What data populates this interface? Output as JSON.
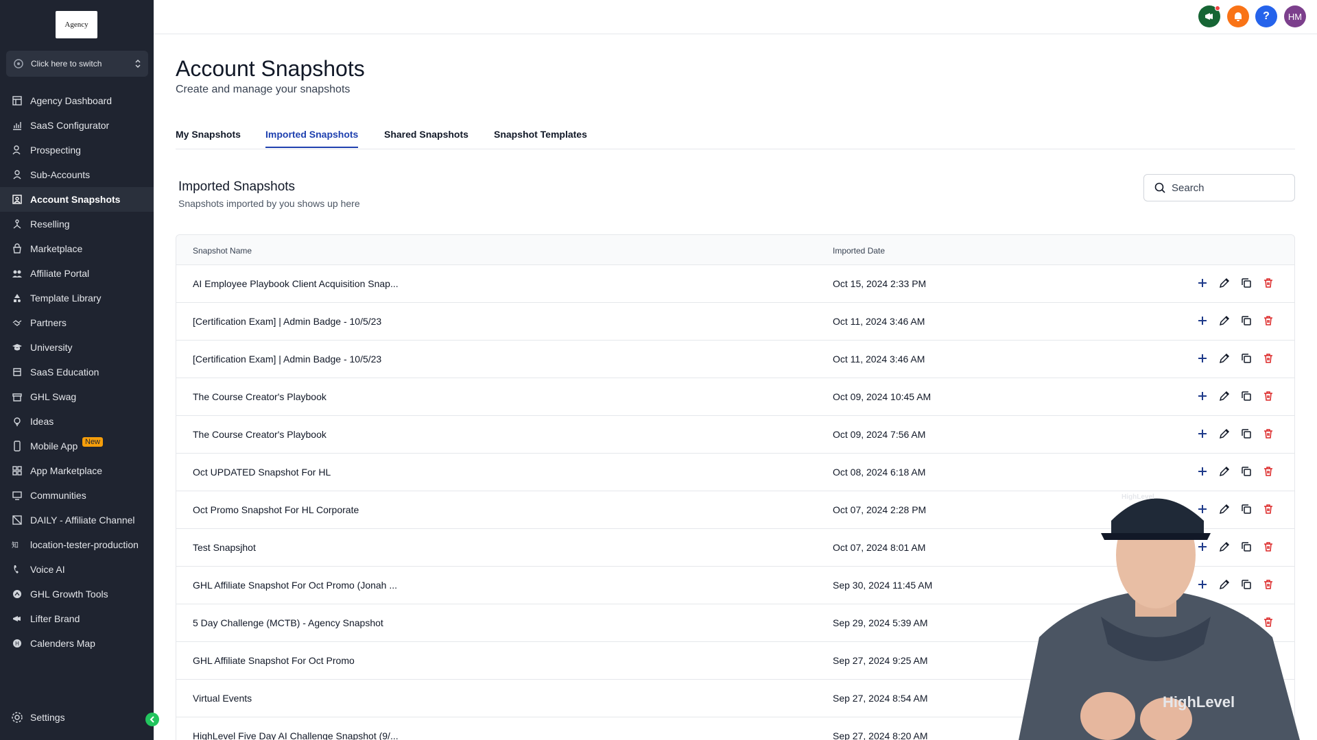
{
  "sidebar": {
    "logo_text": "Agency",
    "switcher_label": "Click here to switch",
    "items": [
      {
        "label": "Agency Dashboard",
        "icon": "dashboard-icon"
      },
      {
        "label": "SaaS Configurator",
        "icon": "chart-icon"
      },
      {
        "label": "Prospecting",
        "icon": "prospecting-icon"
      },
      {
        "label": "Sub-Accounts",
        "icon": "user-icon"
      },
      {
        "label": "Account Snapshots",
        "icon": "snapshot-icon"
      },
      {
        "label": "Reselling",
        "icon": "reselling-icon"
      },
      {
        "label": "Marketplace",
        "icon": "bag-icon"
      },
      {
        "label": "Affiliate Portal",
        "icon": "users-icon"
      },
      {
        "label": "Template Library",
        "icon": "shapes-icon"
      },
      {
        "label": "Partners",
        "icon": "handshake-icon"
      },
      {
        "label": "University",
        "icon": "graduation-icon"
      },
      {
        "label": "SaaS Education",
        "icon": "education-icon"
      },
      {
        "label": "GHL Swag",
        "icon": "store-icon"
      },
      {
        "label": "Ideas",
        "icon": "bulb-icon"
      },
      {
        "label": "Mobile App",
        "icon": "phone-icon",
        "badge": "New"
      },
      {
        "label": "App Marketplace",
        "icon": "grid-icon"
      },
      {
        "label": "Communities",
        "icon": "community-icon"
      },
      {
        "label": "DAILY - Affiliate Channel",
        "icon": "channel-icon"
      },
      {
        "label": "location-tester-production",
        "icon": "location-icon"
      },
      {
        "label": "Voice AI",
        "icon": "phone-call-icon"
      },
      {
        "label": "GHL Growth Tools",
        "icon": "growth-icon"
      },
      {
        "label": "Lifter Brand",
        "icon": "megaphone-icon"
      },
      {
        "label": "Calenders Map",
        "icon": "calendar-icon"
      }
    ],
    "settings_label": "Settings"
  },
  "topbar": {
    "avatar_initials": "HM",
    "help_glyph": "?"
  },
  "page": {
    "title": "Account Snapshots",
    "subtitle": "Create and manage your snapshots",
    "tabs": [
      {
        "label": "My Snapshots"
      },
      {
        "label": "Imported Snapshots",
        "active": true
      },
      {
        "label": "Shared Snapshots"
      },
      {
        "label": "Snapshot Templates"
      }
    ]
  },
  "section": {
    "title": "Imported Snapshots",
    "subtitle": "Snapshots imported by you shows up here",
    "search_placeholder": "Search"
  },
  "table": {
    "columns": {
      "name": "Snapshot Name",
      "date": "Imported Date"
    },
    "rows": [
      {
        "name": "AI Employee Playbook Client Acquisition Snap...",
        "date": "Oct 15, 2024 2:33 PM"
      },
      {
        "name": "[Certification Exam] | Admin Badge - 10/5/23",
        "date": "Oct 11, 2024 3:46 AM"
      },
      {
        "name": "[Certification Exam] | Admin Badge - 10/5/23",
        "date": "Oct 11, 2024 3:46 AM"
      },
      {
        "name": "The Course Creator's Playbook",
        "date": "Oct 09, 2024 10:45 AM"
      },
      {
        "name": "The Course Creator's Playbook",
        "date": "Oct 09, 2024 7:56 AM"
      },
      {
        "name": "Oct UPDATED Snapshot For HL",
        "date": "Oct 08, 2024 6:18 AM"
      },
      {
        "name": "Oct Promo Snapshot For HL Corporate",
        "date": "Oct 07, 2024 2:28 PM"
      },
      {
        "name": "Test Snapsjhot",
        "date": "Oct 07, 2024 8:01 AM"
      },
      {
        "name": "GHL Affiliate Snapshot For Oct Promo (Jonah ...",
        "date": "Sep 30, 2024 11:45 AM"
      },
      {
        "name": "5 Day Challenge (MCTB) - Agency Snapshot",
        "date": "Sep 29, 2024 5:39 AM"
      },
      {
        "name": "GHL Affiliate Snapshot For Oct Promo",
        "date": "Sep 27, 2024 9:25 AM"
      },
      {
        "name": "Virtual Events",
        "date": "Sep 27, 2024 8:54 AM"
      },
      {
        "name": "HighLevel Five Day AI Challenge Snapshot (9/...",
        "date": "Sep 27, 2024 8:20 AM"
      }
    ]
  },
  "presenter": {
    "shirt_text": "HighLevel",
    "cap_text": "HighLevel"
  },
  "colors": {
    "sidebar_bg": "#1f2430",
    "accent": "#1e40af",
    "delete": "#dc2626",
    "add": "#1e3a8a"
  }
}
